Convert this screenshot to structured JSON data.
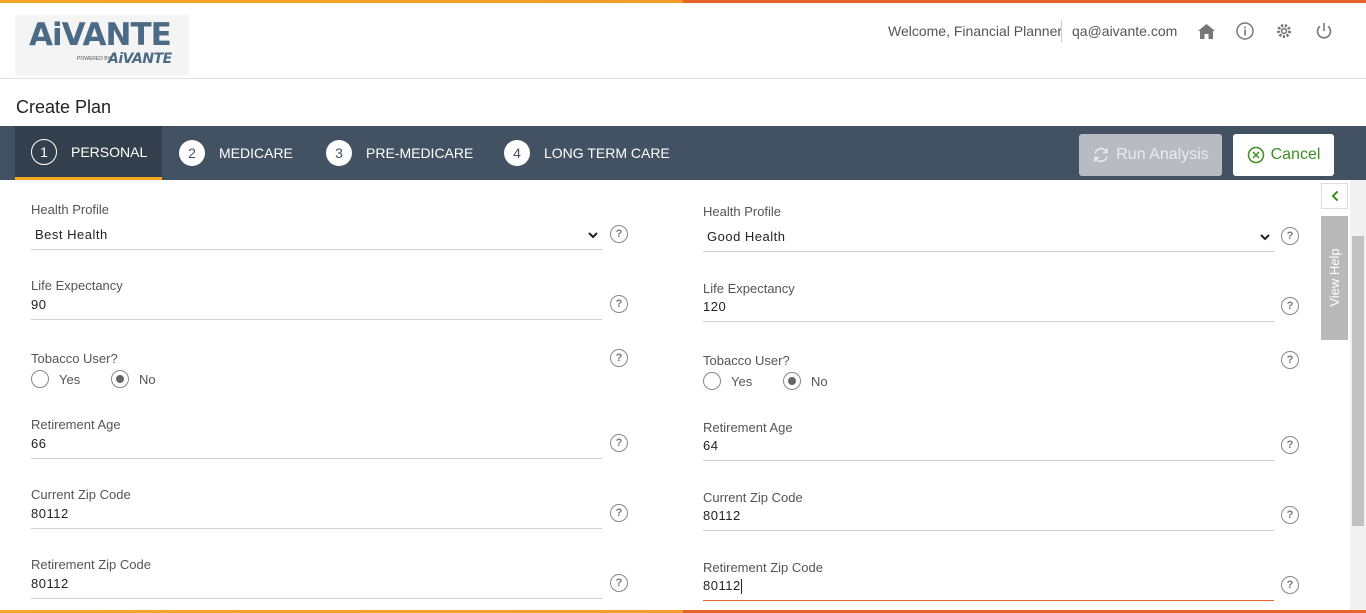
{
  "header": {
    "logo_text": "AiVANTE",
    "logo_powered": "POWERED BY",
    "logo_sub": "AiVANTE",
    "welcome": "Welcome, Financial Planner",
    "email": "qa@aivante.com",
    "icons": [
      "home-icon",
      "info-icon",
      "gear-icon",
      "power-icon"
    ]
  },
  "page_title": "Create Plan",
  "steps": [
    {
      "num": "1",
      "label": "PERSONAL",
      "active": true
    },
    {
      "num": "2",
      "label": "MEDICARE",
      "active": false
    },
    {
      "num": "3",
      "label": "PRE-MEDICARE",
      "active": false
    },
    {
      "num": "4",
      "label": "LONG TERM CARE",
      "active": false
    }
  ],
  "actions": {
    "run_analysis": "Run Analysis",
    "cancel": "Cancel"
  },
  "help": {
    "view_help": "View Help"
  },
  "left": {
    "health_profile_label": "Health Profile",
    "health_profile_value": "Best Health",
    "life_expectancy_label": "Life Expectancy",
    "life_expectancy_value": "90",
    "tobacco_label": "Tobacco User?",
    "tobacco_yes": "Yes",
    "tobacco_no": "No",
    "tobacco_selected": "No",
    "retirement_age_label": "Retirement Age",
    "retirement_age_value": "66",
    "current_zip_label": "Current Zip Code",
    "current_zip_value": "80112",
    "retirement_zip_label": "Retirement Zip Code",
    "retirement_zip_value": "80112"
  },
  "right": {
    "health_profile_label": "Health Profile",
    "health_profile_value": "Good Health",
    "life_expectancy_label": "Life Expectancy",
    "life_expectancy_value": "120",
    "tobacco_label": "Tobacco User?",
    "tobacco_yes": "Yes",
    "tobacco_no": "No",
    "tobacco_selected": "No",
    "retirement_age_label": "Retirement Age",
    "retirement_age_value": "64",
    "current_zip_label": "Current Zip Code",
    "current_zip_value": "80112",
    "retirement_zip_label": "Retirement Zip Code",
    "retirement_zip_value": "80112"
  },
  "help_glyph": "?"
}
